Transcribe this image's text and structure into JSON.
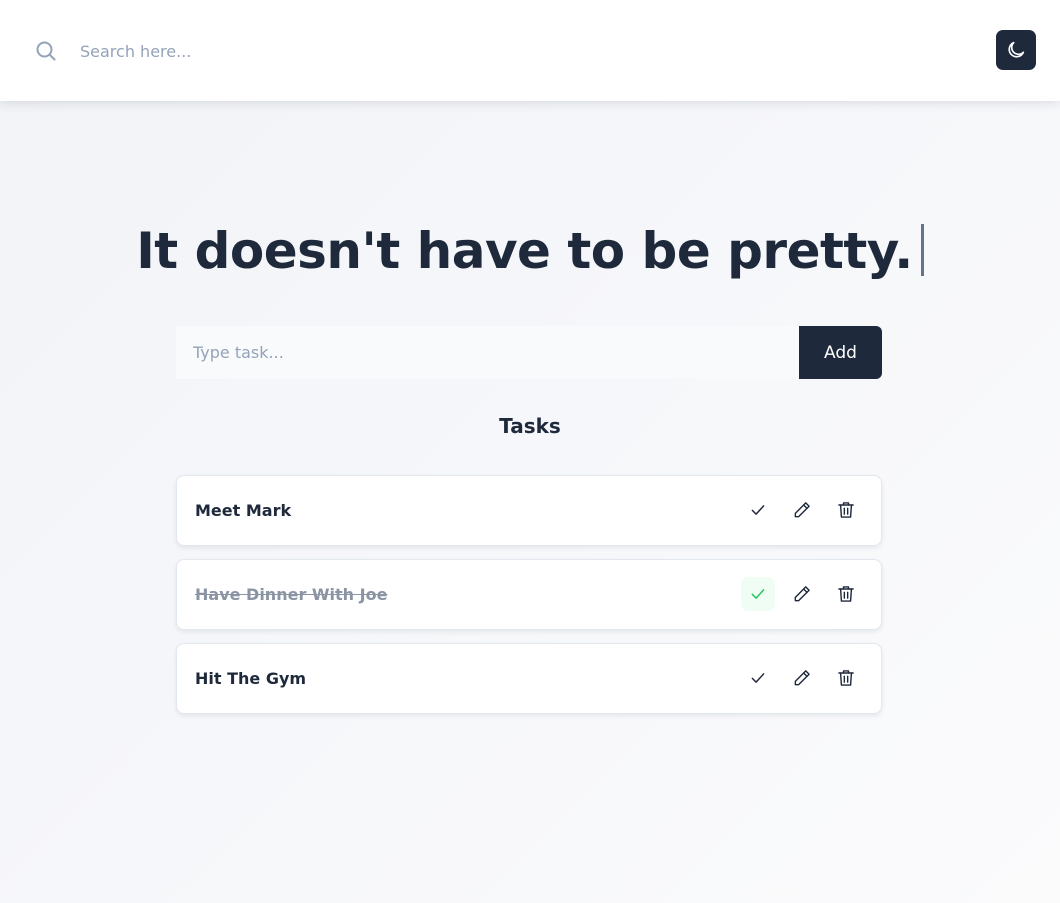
{
  "header": {
    "search": {
      "placeholder": "Search here...",
      "value": ""
    },
    "theme_toggle_icon": "moon-icon"
  },
  "main": {
    "headline": "It doesn't have to be pretty.",
    "task_input": {
      "placeholder": "Type task...",
      "value": ""
    },
    "add_label": "Add",
    "tasks_heading": "Tasks",
    "tasks": [
      {
        "text": "Meet Mark",
        "completed": false
      },
      {
        "text": "Have Dinner With Joe",
        "completed": true
      },
      {
        "text": "Hit The Gym",
        "completed": false
      }
    ],
    "task_action_icons": [
      "check-icon",
      "pencil-icon",
      "trash-icon"
    ]
  },
  "colors": {
    "primary": "#1e293b",
    "completed_check": "#22c55e",
    "completed_check_bg": "#f0fdf4",
    "muted_text": "#8a94a3",
    "placeholder": "#94a3b8"
  }
}
